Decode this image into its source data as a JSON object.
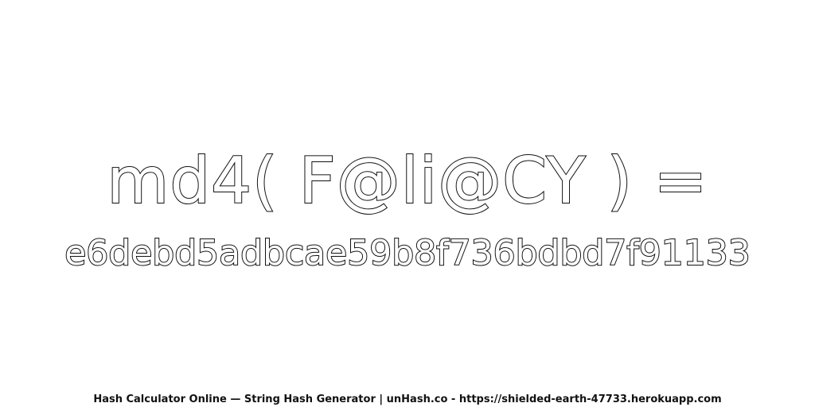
{
  "expression": "md4( F@li@CY ) =",
  "hash": "e6debd5adbcae59b8f736bdbd7f91133",
  "footer": "Hash Calculator Online — String Hash Generator | unHash.co - https://shielded-earth-47733.herokuapp.com",
  "colors": {
    "background": "#ffffff",
    "text_fill": "#ffffff",
    "text_outline": "#111111"
  }
}
